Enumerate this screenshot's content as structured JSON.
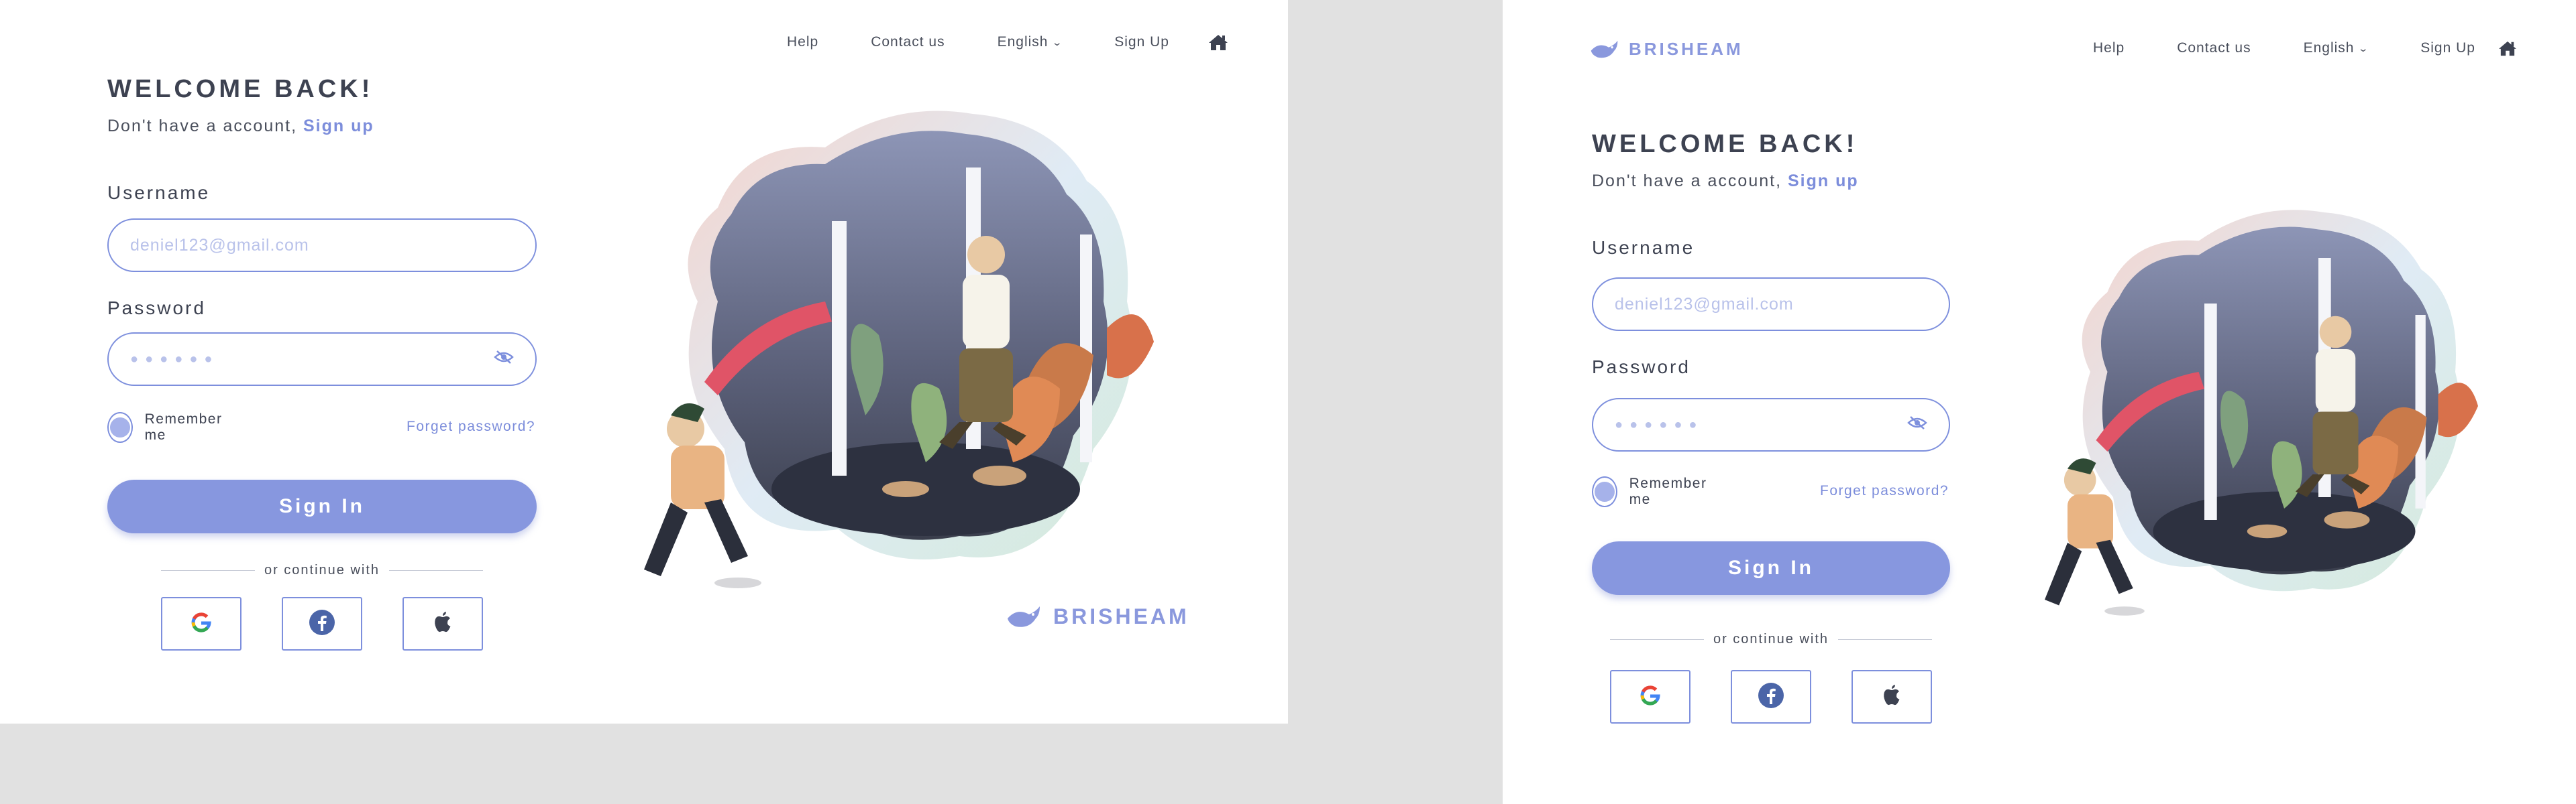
{
  "brand": {
    "name": "BRISHEAM"
  },
  "nav": {
    "help": "Help",
    "contact": "Contact us",
    "language": "English",
    "signup": "Sign Up"
  },
  "form": {
    "title": "WELCOME BACK!",
    "subtitle_text": "Don't have a account,",
    "subtitle_link": "Sign up",
    "username_label": "Username",
    "username_placeholder": "deniel123@gmail.com",
    "password_label": "Password",
    "password_mask": "●●●●●●",
    "remember_label": "Remember me",
    "forgot_label": "Forget password?",
    "signin_label": "Sign In",
    "continue_label": "or continue with"
  },
  "social": [
    "google-icon",
    "facebook-icon",
    "apple-icon"
  ],
  "colors": {
    "accent": "#8797df",
    "link": "#7c8ddb",
    "text": "#3d4251",
    "backdrop": "#e1e1e1",
    "frame": "#ffffff"
  },
  "icons": {
    "home": "home-icon",
    "eye": "eye-slash-icon",
    "chevron": "chevron-down-icon",
    "logo": "bird-logo-icon"
  }
}
